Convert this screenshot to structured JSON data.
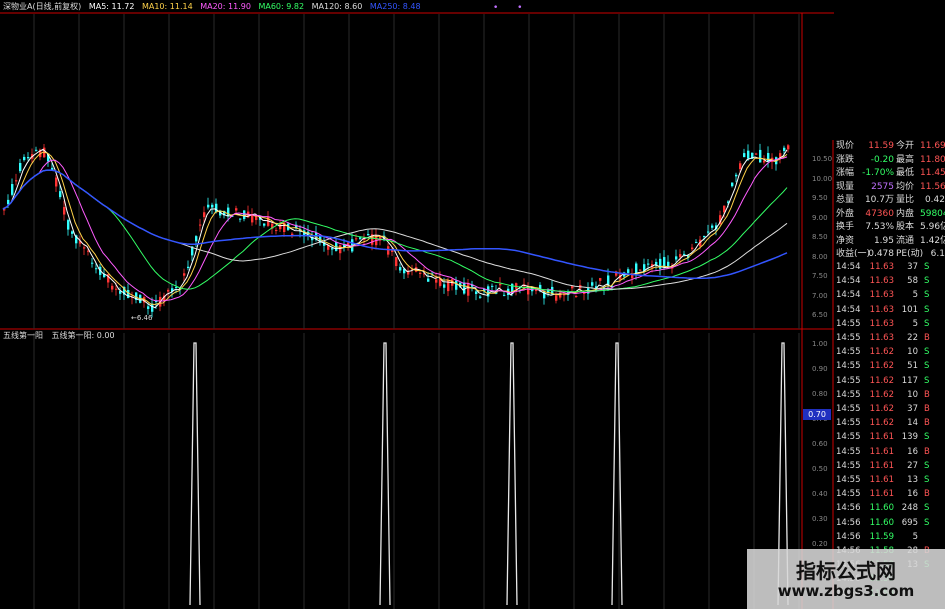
{
  "title_bar": {
    "stock": "深物业A(日线,前复权)",
    "ma5": "MA5: 11.72",
    "ma10": "MA10: 11.14",
    "ma20": "MA20: 11.90",
    "ma60": "MA60: 9.82",
    "ma120": "MA120: 8.60",
    "ma250": "MA250: 8.48"
  },
  "colors": {
    "ma5": "#ffffff",
    "ma10": "#ffd24a",
    "ma20": "#ff5cff",
    "ma60": "#33ff66",
    "ma120": "#dddddd",
    "ma250": "#3355ff",
    "up": "#ff3333",
    "down": "#33ffff",
    "grid_red": "#cc0000"
  },
  "dots": "• •",
  "low_marker": "←6.46",
  "price_axis": [
    "10.50",
    "10.00",
    "9.50",
    "9.00",
    "8.50",
    "8.00",
    "7.50",
    "7.00",
    "6.50"
  ],
  "indicator": {
    "name": "五线第一阳",
    "value_label": "五线第一阳: 0.00"
  },
  "indicator_axis": [
    "1.00",
    "0.90",
    "0.80",
    "0.70",
    "0.60",
    "0.50",
    "0.40",
    "0.30",
    "0.20",
    "0.10"
  ],
  "indicator_current": "0.70",
  "quote": [
    {
      "l1": "现价",
      "v1": "11.59",
      "c1": "#ff5555",
      "l2": "今开",
      "v2": "11.69",
      "c2": "#ff5555"
    },
    {
      "l1": "涨跌",
      "v1": "-0.20",
      "c1": "#33ff66",
      "l2": "最高",
      "v2": "11.80",
      "c2": "#ff5555"
    },
    {
      "l1": "涨幅",
      "v1": "-1.70%",
      "c1": "#33ff66",
      "l2": "最低",
      "v2": "11.45",
      "c2": "#ff5555"
    },
    {
      "l1": "现量",
      "v1": "2575",
      "c1": "#c070ff",
      "l2": "均价",
      "v2": "11.56",
      "c2": "#ff5555"
    },
    {
      "l1": "总量",
      "v1": "10.7万",
      "c1": "#dddddd",
      "l2": "量比",
      "v2": "0.42",
      "c2": "#dddddd"
    },
    {
      "l1": "外盘",
      "v1": "47360",
      "c1": "#ff5555",
      "l2": "内盘",
      "v2": "59804",
      "c2": "#33ff66"
    },
    {
      "l1": "换手",
      "v1": "7.53%",
      "c1": "#dddddd",
      "l2": "股本",
      "v2": "5.96亿",
      "c2": "#dddddd"
    },
    {
      "l1": "净资",
      "v1": "1.95",
      "c1": "#dddddd",
      "l2": "流通",
      "v2": "1.42亿",
      "c2": "#dddddd"
    },
    {
      "l1": "收益(一)",
      "v1": "0.478",
      "c1": "#dddddd",
      "l2": "PE(动)",
      "v2": "6.1",
      "c2": "#dddddd"
    }
  ],
  "ticks": [
    {
      "t": "14:54",
      "p": "11.63",
      "pc": "#ff5555",
      "v": "37",
      "s": "S",
      "sc": "#33ff66"
    },
    {
      "t": "14:54",
      "p": "11.63",
      "pc": "#ff5555",
      "v": "58",
      "s": "S",
      "sc": "#33ff66"
    },
    {
      "t": "14:54",
      "p": "11.63",
      "pc": "#ff5555",
      "v": "5",
      "s": "S",
      "sc": "#33ff66"
    },
    {
      "t": "14:54",
      "p": "11.63",
      "pc": "#ff5555",
      "v": "101",
      "s": "S",
      "sc": "#33ff66"
    },
    {
      "t": "14:55",
      "p": "11.63",
      "pc": "#ff5555",
      "v": "5",
      "s": "S",
      "sc": "#33ff66"
    },
    {
      "t": "14:55",
      "p": "11.63",
      "pc": "#ff5555",
      "v": "22",
      "s": "B",
      "sc": "#ff5555"
    },
    {
      "t": "14:55",
      "p": "11.62",
      "pc": "#ff5555",
      "v": "10",
      "s": "S",
      "sc": "#33ff66"
    },
    {
      "t": "14:55",
      "p": "11.62",
      "pc": "#ff5555",
      "v": "51",
      "s": "S",
      "sc": "#33ff66"
    },
    {
      "t": "14:55",
      "p": "11.62",
      "pc": "#ff5555",
      "v": "117",
      "s": "S",
      "sc": "#33ff66"
    },
    {
      "t": "14:55",
      "p": "11.62",
      "pc": "#ff5555",
      "v": "10",
      "s": "B",
      "sc": "#ff5555"
    },
    {
      "t": "14:55",
      "p": "11.62",
      "pc": "#ff5555",
      "v": "37",
      "s": "B",
      "sc": "#ff5555"
    },
    {
      "t": "14:55",
      "p": "11.62",
      "pc": "#ff5555",
      "v": "14",
      "s": "B",
      "sc": "#ff5555"
    },
    {
      "t": "14:55",
      "p": "11.61",
      "pc": "#ff5555",
      "v": "139",
      "s": "S",
      "sc": "#33ff66"
    },
    {
      "t": "14:55",
      "p": "11.61",
      "pc": "#ff5555",
      "v": "16",
      "s": "B",
      "sc": "#ff5555"
    },
    {
      "t": "14:55",
      "p": "11.61",
      "pc": "#ff5555",
      "v": "27",
      "s": "S",
      "sc": "#33ff66"
    },
    {
      "t": "14:55",
      "p": "11.61",
      "pc": "#ff5555",
      "v": "13",
      "s": "S",
      "sc": "#33ff66"
    },
    {
      "t": "14:55",
      "p": "11.61",
      "pc": "#ff5555",
      "v": "16",
      "s": "B",
      "sc": "#ff5555"
    },
    {
      "t": "14:56",
      "p": "11.60",
      "pc": "#33ff66",
      "v": "248",
      "s": "S",
      "sc": "#33ff66"
    },
    {
      "t": "14:56",
      "p": "11.60",
      "pc": "#33ff66",
      "v": "695",
      "s": "S",
      "sc": "#33ff66"
    },
    {
      "t": "14:56",
      "p": "11.59",
      "pc": "#33ff66",
      "v": "5",
      "s": "",
      "sc": "#dddddd"
    },
    {
      "t": "14:56",
      "p": "11.58",
      "pc": "#33ff66",
      "v": "28",
      "s": "B",
      "sc": "#ff5555"
    },
    {
      "t": "14:56",
      "p": "11.59",
      "pc": "#33ff66",
      "v": "13",
      "s": "S",
      "sc": "#33ff66"
    },
    {
      "t": "14:56",
      "p": "11.59",
      "pc": "#33ff66",
      "v": "",
      "s": "",
      "sc": "#dddddd"
    },
    {
      "t": "14:56",
      "p": "11.59",
      "pc": "#33ff66",
      "v": "",
      "s": "",
      "sc": "#dddddd"
    }
  ],
  "watermark": {
    "line1": "指标公式网",
    "line2": "www.zbgs3.com"
  }
}
